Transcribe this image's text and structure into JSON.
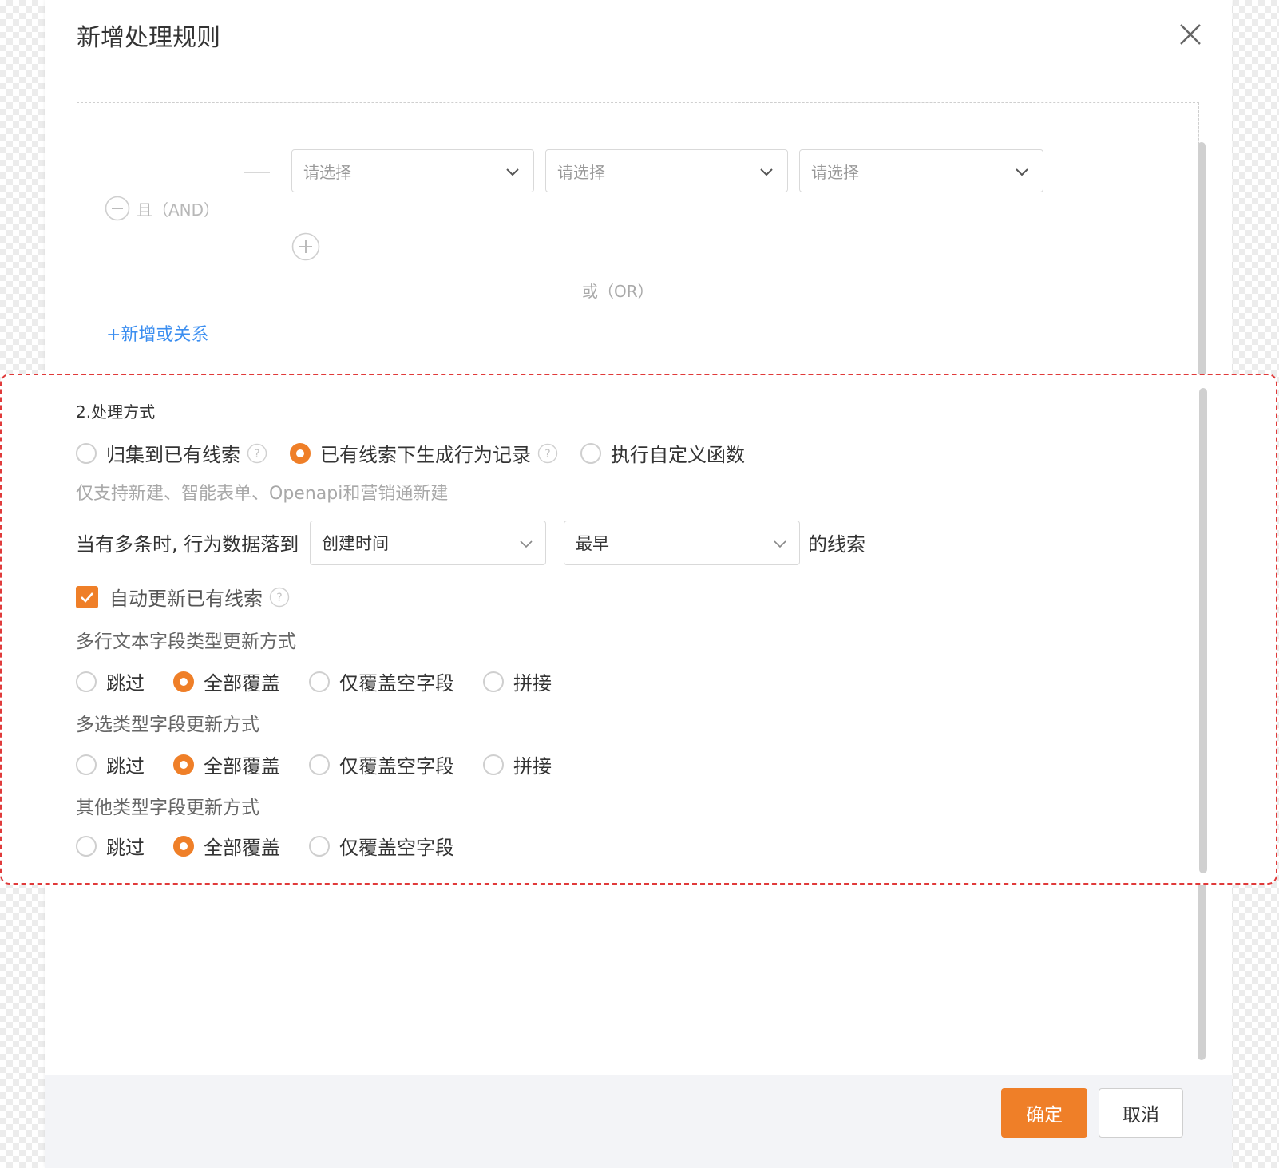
{
  "modal": {
    "title": "新增处理规则",
    "close_icon": "close-icon"
  },
  "condition": {
    "logic_label": "且（AND）",
    "selects": [
      "请选择",
      "请选择",
      "请选择"
    ],
    "or_label": "或（OR）",
    "add_or_link": "+新增或关系"
  },
  "process": {
    "section_title": "2.处理方式",
    "mode_options": [
      {
        "label": "归集到已有线索",
        "selected": false,
        "help": true
      },
      {
        "label": "已有线索下生成行为记录",
        "selected": true,
        "help": true
      },
      {
        "label": "执行自定义函数",
        "selected": false,
        "help": false
      }
    ],
    "hint": "仅支持新建、智能表单、Openapi和营销通新建",
    "fall_label": "当有多条时, 行为数据落到",
    "sort_field": "创建时间",
    "sort_order": "最早",
    "suffix_label": "的线索",
    "auto_update_label": "自动更新已有线索",
    "auto_update_checked": true,
    "groups": [
      {
        "title": "多行文本字段类型更新方式",
        "options": [
          "跳过",
          "全部覆盖",
          "仅覆盖空字段",
          "拼接"
        ],
        "selected": 1
      },
      {
        "title": "多选类型字段更新方式",
        "options": [
          "跳过",
          "全部覆盖",
          "仅覆盖空字段",
          "拼接"
        ],
        "selected": 1
      },
      {
        "title": "其他类型字段更新方式",
        "options": [
          "跳过",
          "全部覆盖",
          "仅覆盖空字段"
        ],
        "selected": 1
      }
    ]
  },
  "footer": {
    "confirm_label": "确定",
    "cancel_label": "取消"
  },
  "colors": {
    "accent": "#ef7f28",
    "link": "#3b8ef0",
    "highlight_border": "#e03a3a"
  }
}
